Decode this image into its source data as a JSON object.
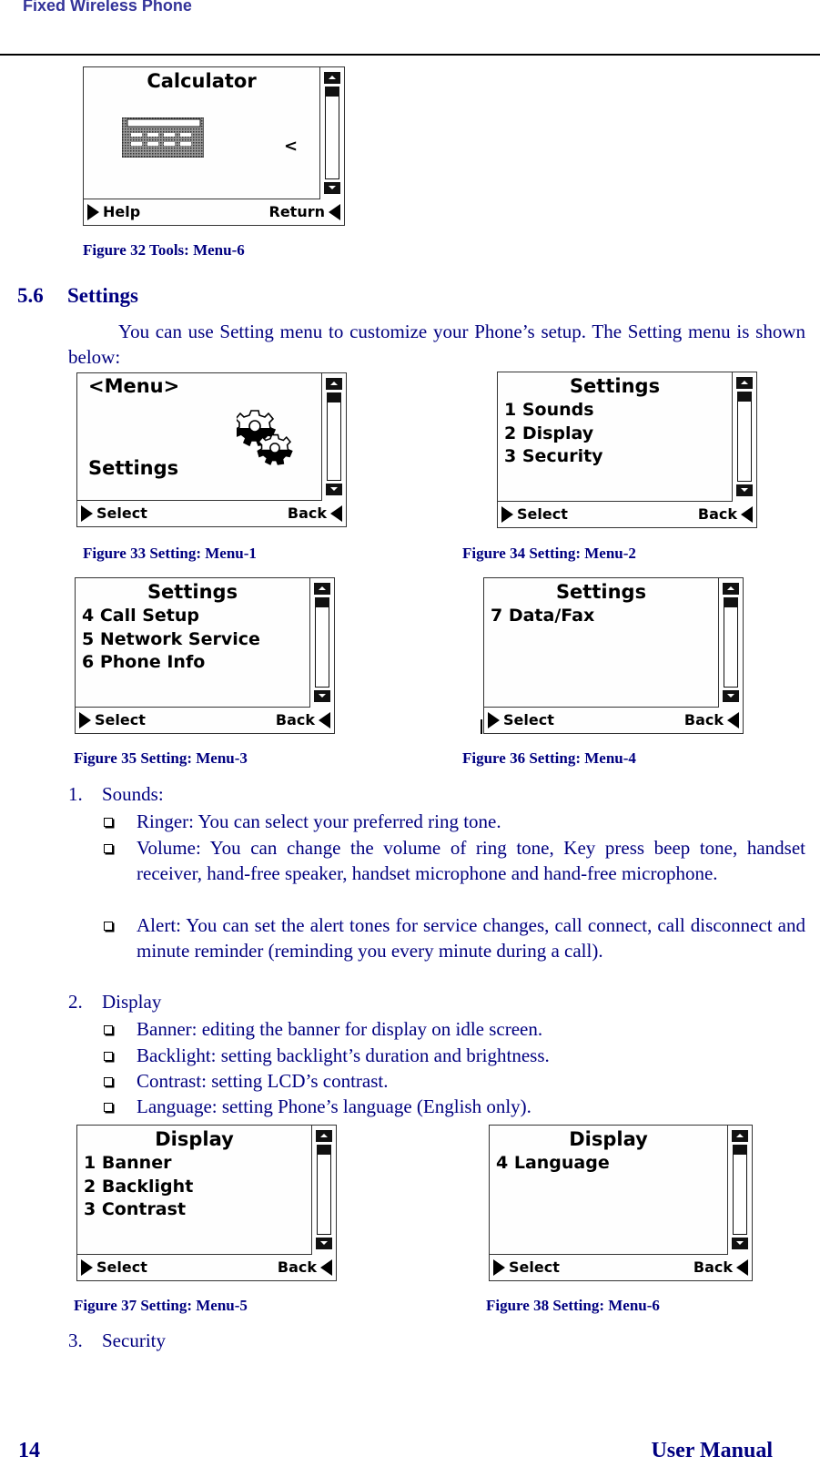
{
  "header": {
    "title": "Fixed Wireless Phone"
  },
  "figures": {
    "fig32": {
      "caption": "Figure 32 Tools: Menu-6",
      "screen_title": "Calculator",
      "cursor_glyph": "<",
      "icon": "calculator-icon",
      "softkey_left": "Help",
      "softkey_right": "Return"
    },
    "fig33": {
      "caption": "Figure 33 Setting: Menu-1",
      "screen_top": "<Menu>",
      "screen_bottom": "Settings",
      "icon": "gears-icon",
      "softkey_left": "Select",
      "softkey_right": "Back"
    },
    "fig34": {
      "caption": "Figure 34 Setting: Menu-2",
      "screen_title": "Settings",
      "items": [
        "1 Sounds",
        "2 Display",
        "3 Security"
      ],
      "softkey_left": "Select",
      "softkey_right": "Back"
    },
    "fig35": {
      "caption": "Figure 35 Setting: Menu-3",
      "screen_title": "Settings",
      "items": [
        "4 Call Setup",
        "5 Network Service",
        "6 Phone Info"
      ],
      "softkey_left": "Select",
      "softkey_right": "Back"
    },
    "fig36": {
      "caption": "Figure 36 Setting: Menu-4",
      "screen_title": "Settings",
      "items": [
        "7 Data/Fax"
      ],
      "softkey_left": "Select",
      "softkey_right": "Back"
    },
    "fig37": {
      "caption": "Figure 37 Setting: Menu-5",
      "screen_title": "Display",
      "items": [
        "1 Banner",
        "2 Backlight",
        "3 Contrast"
      ],
      "softkey_left": "Select",
      "softkey_right": "Back"
    },
    "fig38": {
      "caption": "Figure 38 Setting: Menu-6",
      "screen_title": "Display",
      "items": [
        "4 Language"
      ],
      "softkey_left": "Select",
      "softkey_right": "Back"
    }
  },
  "section": {
    "number": "5.6",
    "title": "Settings",
    "intro": "You can use Setting menu to customize your Phone’s setup. The Setting menu is shown below:"
  },
  "list": [
    {
      "number": "1.",
      "label": "Sounds:",
      "bullets": [
        "Ringer: You can select your preferred ring tone.",
        "Volume: You can change the volume of ring tone, Key press beep tone, handset receiver,  hand-free speaker, handset microphone and hand-free microphone.",
        "Alert: You can set the alert tones for service changes, call connect, call disconnect and minute reminder (reminding you every minute during a call)."
      ]
    },
    {
      "number": "2.",
      "label": "Display",
      "bullets": [
        "Banner:  editing the banner for display on idle screen.",
        "Backlight: setting  backlight’s duration and brightness.",
        "Contrast: setting LCD’s contrast.",
        "Language: setting Phone’s language (English only)."
      ]
    },
    {
      "number": "3.",
      "label": "Security",
      "bullets": []
    }
  ],
  "footer": {
    "page_number": "14",
    "title": "User Manual"
  }
}
